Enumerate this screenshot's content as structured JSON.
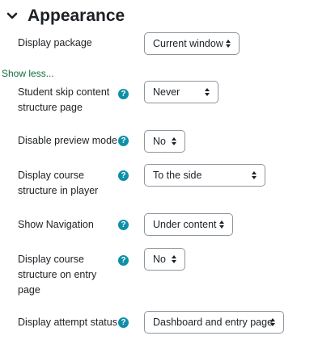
{
  "section": {
    "title": "Appearance"
  },
  "show_less": "Show less...",
  "fields": [
    {
      "label_lines": [
        "Display package"
      ],
      "value": "Current window"
    },
    {
      "label_lines": [
        "Student skip content",
        "structure page"
      ],
      "value": "Never"
    },
    {
      "label_lines": [
        "Disable preview mode"
      ],
      "value": "No"
    },
    {
      "label_lines": [
        "Display course",
        "structure in player"
      ],
      "value": "To the side"
    },
    {
      "label_lines": [
        "Show Navigation"
      ],
      "value": "Under content"
    },
    {
      "label_lines": [
        "Display course",
        "structure on entry",
        "page"
      ],
      "value": "No"
    },
    {
      "label_lines": [
        "Display attempt status"
      ],
      "value": "Dashboard and entry page"
    }
  ],
  "help_glyph": "?",
  "icons": {
    "collapse": "chevron-down-icon",
    "help": "question-circle-icon",
    "select": "sort-caret-icon"
  },
  "colors": {
    "help": "#0f8fa8",
    "link": "#0f6e3c",
    "border": "#8f959e",
    "text": "#1d2125"
  }
}
